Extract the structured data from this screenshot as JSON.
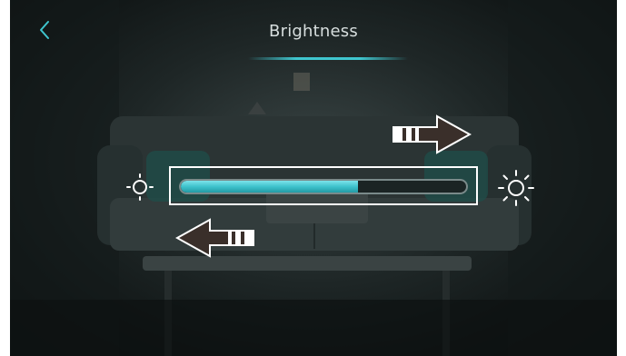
{
  "header": {
    "title": "Brightness",
    "back_icon": "chevron-left-icon"
  },
  "brightness": {
    "level_fraction": 0.62,
    "min_icon": "sun-dim-icon",
    "max_icon": "sun-bright-icon"
  },
  "hints": {
    "increase_icon": "arrow-right-icon",
    "decrease_icon": "arrow-left-icon"
  },
  "colors": {
    "accent": "#3fc6cf",
    "text": "#d7dede",
    "background": "#1e2626"
  }
}
